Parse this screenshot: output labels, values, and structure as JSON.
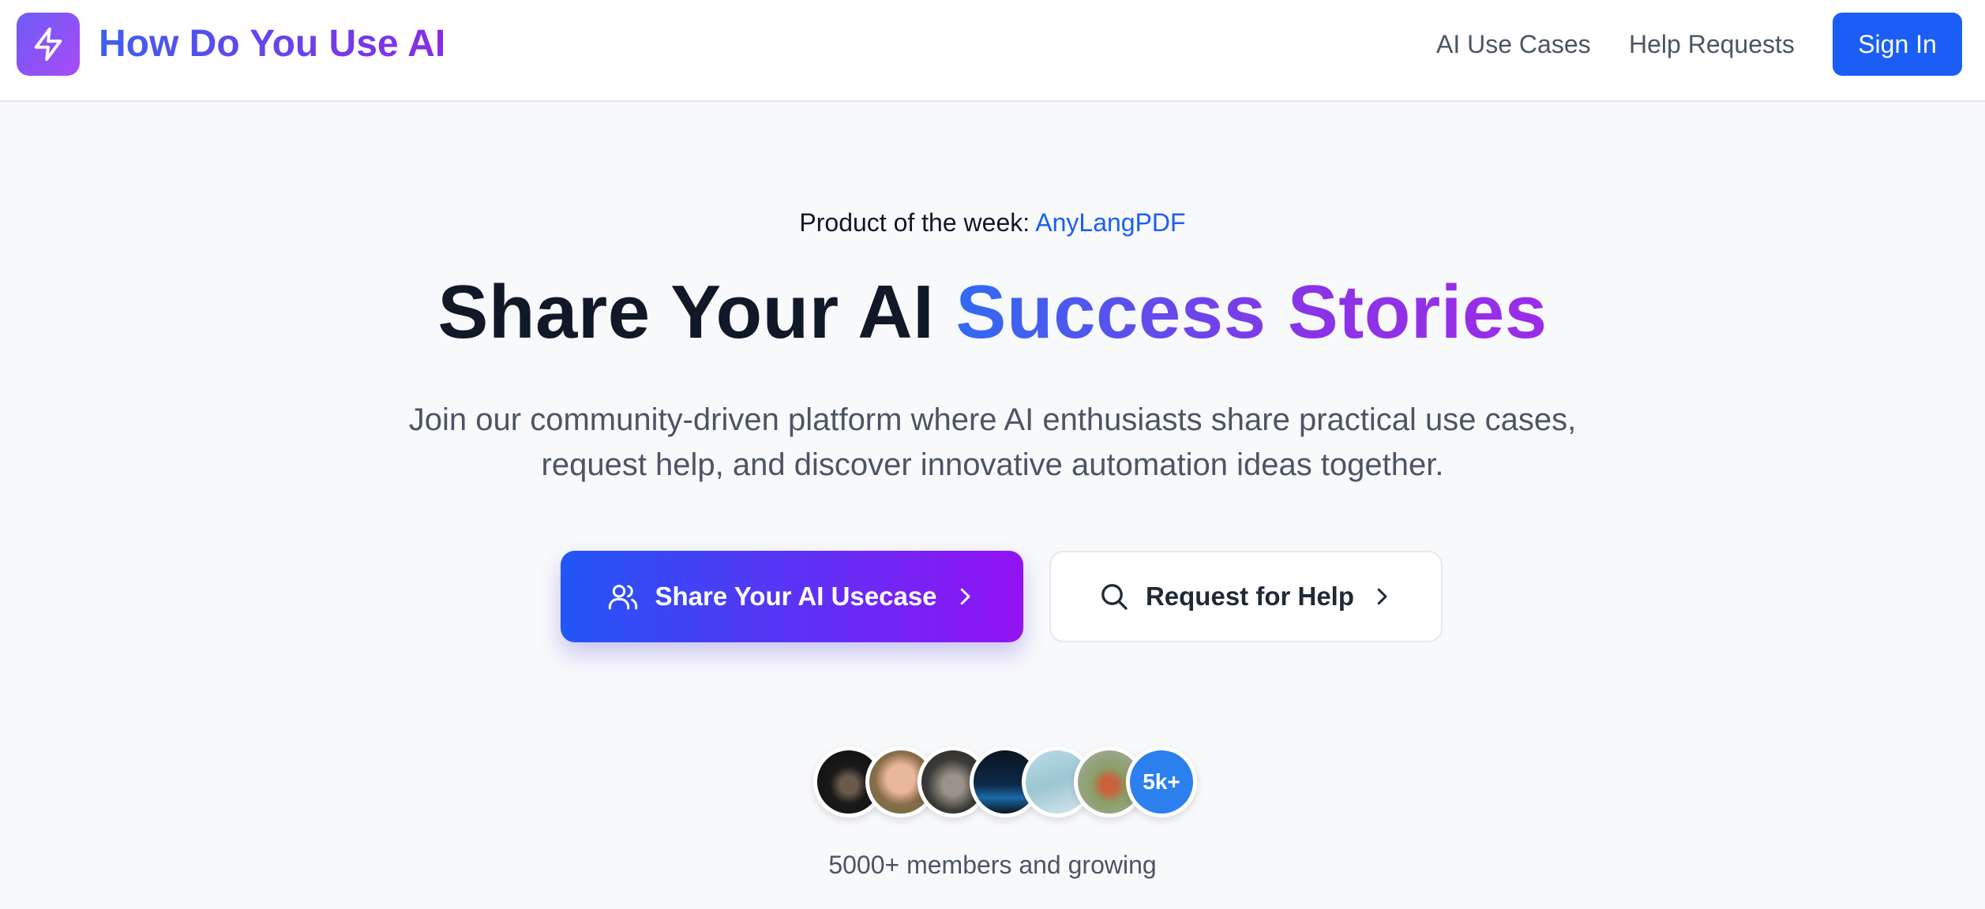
{
  "header": {
    "logo_icon": "lightning-bolt-icon",
    "brand": "How Do You Use AI",
    "nav": [
      {
        "label": "AI Use Cases"
      },
      {
        "label": "Help Requests"
      }
    ],
    "sign_in": "Sign In"
  },
  "hero": {
    "product_of_week_prefix": "Product of the week: ",
    "product_of_week_link": "AnyLangPDF",
    "title_plain": "Share Your AI ",
    "title_highlight": "Success Stories",
    "subtitle_line1": "Join our community-driven platform where AI enthusiasts share practical use cases,",
    "subtitle_line2": "request help, and discover innovative automation ideas together.",
    "primary_button": {
      "label": "Share Your AI Usecase",
      "icon": "users-icon",
      "trailing_icon": "chevron-right-icon"
    },
    "secondary_button": {
      "label": "Request for Help",
      "icon": "search-icon",
      "trailing_icon": "chevron-right-icon"
    }
  },
  "community": {
    "count_badge": "5k+",
    "members_text": "5000+ members and growing"
  },
  "colors": {
    "accent_blue": "#1a5ef5",
    "gradient_start": "#2155f6",
    "gradient_end": "#9312f2"
  }
}
